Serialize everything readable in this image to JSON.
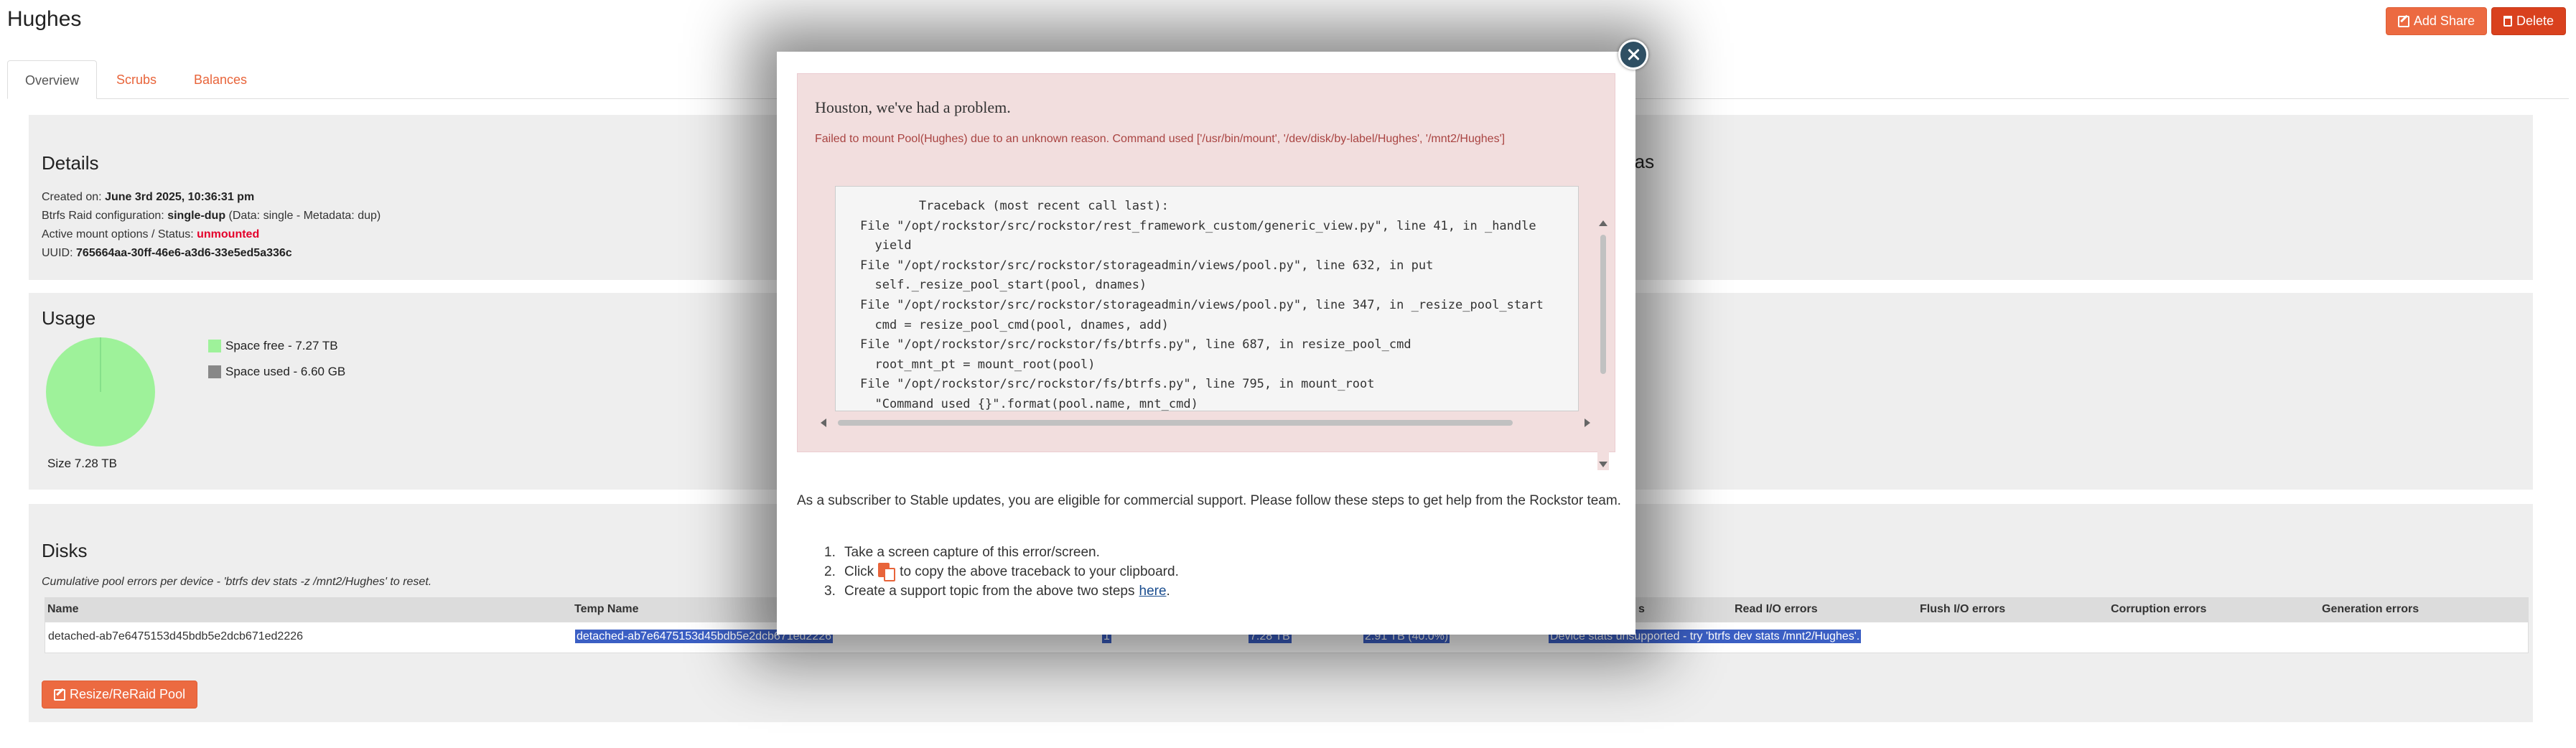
{
  "page": {
    "title": "Hughes",
    "add_share": "Add Share",
    "delete": "Delete"
  },
  "tabs": [
    {
      "label": "Overview"
    },
    {
      "label": "Scrubs"
    },
    {
      "label": "Balances"
    }
  ],
  "details": {
    "title": "Details",
    "created_label": "Created on:",
    "created_value": "June 3rd 2025, 10:36:31 pm",
    "raid_label": "Btrfs Raid configuration:",
    "raid_value": "single-dup",
    "raid_extra": "(Data: single - Metadata: dup)",
    "mount_label": "Active mount options / Status:",
    "mount_value": "unmounted",
    "uuid_label": "UUID:",
    "uuid_value": "765664aa-30ff-46e6-a3d6-33e5ed5a336c",
    "quotas_partial": "otas"
  },
  "usage": {
    "title": "Usage",
    "free_label": "Space free - 7.27 TB",
    "used_label": "Space used - 6.60 GB",
    "size_label": "Size 7.28 TB",
    "free_color": "#9ef29a",
    "used_color": "#888888"
  },
  "disks": {
    "title": "Disks",
    "note": "Cumulative pool errors per device - 'btrfs dev stats -z /mnt2/Hughes' to reset.",
    "columns": [
      "Name",
      "Temp Name",
      "Read I/O errors",
      "Flush I/O errors",
      "Corruption errors",
      "Generation errors"
    ],
    "columns_partial": "s",
    "row": {
      "name": "detached-ab7e6475153d45bdb5e2dcb671ed2226",
      "temp_name": "detached-ab7e6475153d45bdb5e2dcb671ed2226",
      "devid": "1",
      "size": "7.28 TB",
      "allocated": "2.91 TB (40.0%)",
      "stats": "Device stats unsupported - try 'btrfs dev stats /mnt2/Hughes'."
    },
    "resize_button": "Resize/ReRaid Pool"
  },
  "modal": {
    "alert_title": "Houston, we've had a problem.",
    "alert_message": "Failed to mount Pool(Hughes) due to an unknown reason. Command used ['/usr/bin/mount', '/dev/disk/by-label/Hughes', '/mnt2/Hughes']",
    "traceback": [
      "        Traceback (most recent call last):",
      "File \"/opt/rockstor/src/rockstor/rest_framework_custom/generic_view.py\", line 41, in _handle",
      "  yield",
      "File \"/opt/rockstor/src/rockstor/storageadmin/views/pool.py\", line 632, in put",
      "  self._resize_pool_start(pool, dnames)",
      "File \"/opt/rockstor/src/rockstor/storageadmin/views/pool.py\", line 347, in _resize_pool_start",
      "  cmd = resize_pool_cmd(pool, dnames, add)",
      "File \"/opt/rockstor/src/rockstor/fs/btrfs.py\", line 687, in resize_pool_cmd",
      "  root_mnt_pt = mount_root(pool)",
      "File \"/opt/rockstor/src/rockstor/fs/btrfs.py\", line 795, in mount_root",
      "  \"Command used {}\".format(pool.name, mnt_cmd)"
    ],
    "support_text": "As a subscriber to Stable updates, you are eligible for commercial support. Please follow these steps to get help from the Rockstor team.",
    "step1": "Take a screen capture of this error/screen.",
    "step2_pre": "Click",
    "step2_post": "to copy the above traceback to your clipboard.",
    "step3_pre": "Create a support topic from the above two steps",
    "step3_link": "here",
    "step3_post": "."
  }
}
